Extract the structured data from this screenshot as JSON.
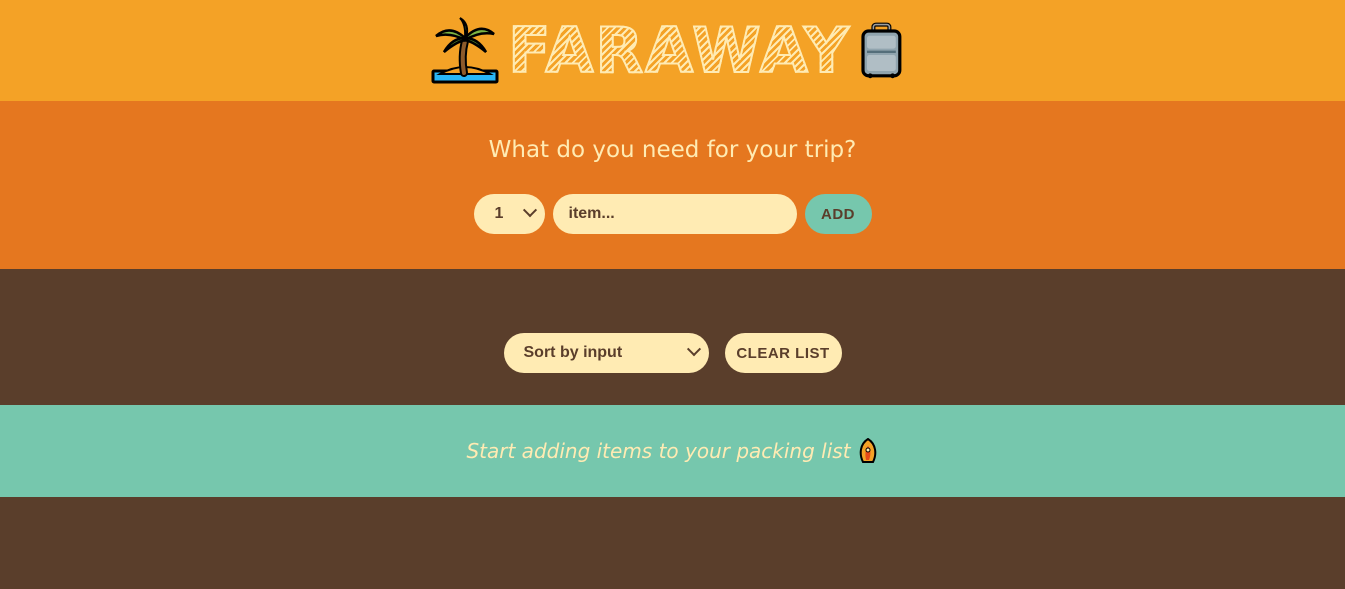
{
  "header": {
    "logo_text": "FARAWAY",
    "left_icon": "palm-tree-island-icon",
    "right_icon": "luggage-icon"
  },
  "form": {
    "title": "What do you need for your trip?",
    "quantity_value": "1",
    "item_placeholder": "item...",
    "add_label": "ADD"
  },
  "list": {
    "sort_value": "Sort by input",
    "clear_label": "CLEAR LIST"
  },
  "stats": {
    "message": "Start adding items to your packing list",
    "icon": "rocket-icon"
  },
  "colors": {
    "header_bg": "#f4a226",
    "form_bg": "#e5771f",
    "list_bg": "#5a3e2b",
    "stats_bg": "#76c7ad",
    "cream": "#ffebb3"
  }
}
